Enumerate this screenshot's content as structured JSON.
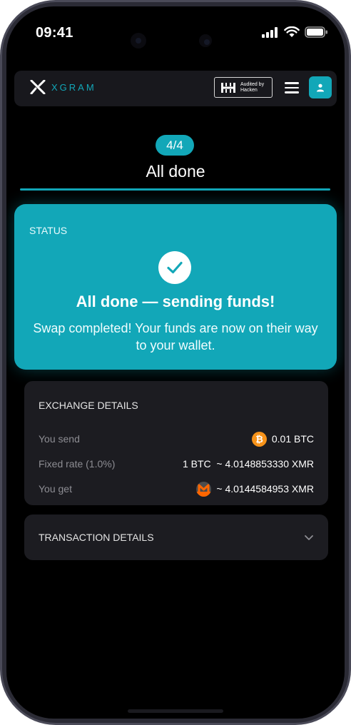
{
  "status_bar": {
    "time": "09:41"
  },
  "header": {
    "brand": "XGRAM",
    "audit_line1": "Audited by",
    "audit_line2": "Hacken",
    "icons": [
      "xgram-logo-icon",
      "hacken-icon",
      "menu-icon",
      "user-icon"
    ]
  },
  "stepper": {
    "step": "4/4",
    "title": "All done"
  },
  "status_card": {
    "label": "STATUS",
    "heading": "All done — sending funds!",
    "message": "Swap completed! Your funds are now on their way to your wallet.",
    "icon": "check-icon"
  },
  "exchange_details": {
    "title": "EXCHANGE DETAILS",
    "rows": [
      {
        "label": "You send",
        "value": "0.01 BTC",
        "coin_icon": "bitcoin-icon"
      },
      {
        "label": "Fixed rate (1.0%)",
        "value": "1 BTC  ~ 4.0148853330 XMR"
      },
      {
        "label": "You get",
        "value": "~ 4.0144584953 XMR",
        "coin_icon": "monero-icon"
      }
    ]
  },
  "transaction_details": {
    "title": "TRANSACTION DETAILS",
    "icon": "chevron-down-icon"
  },
  "colors": {
    "accent": "#12a7b8",
    "bitcoin": "#f7931a",
    "monero": "#ff6600",
    "background": "#000000",
    "card": "#1c1c21"
  }
}
